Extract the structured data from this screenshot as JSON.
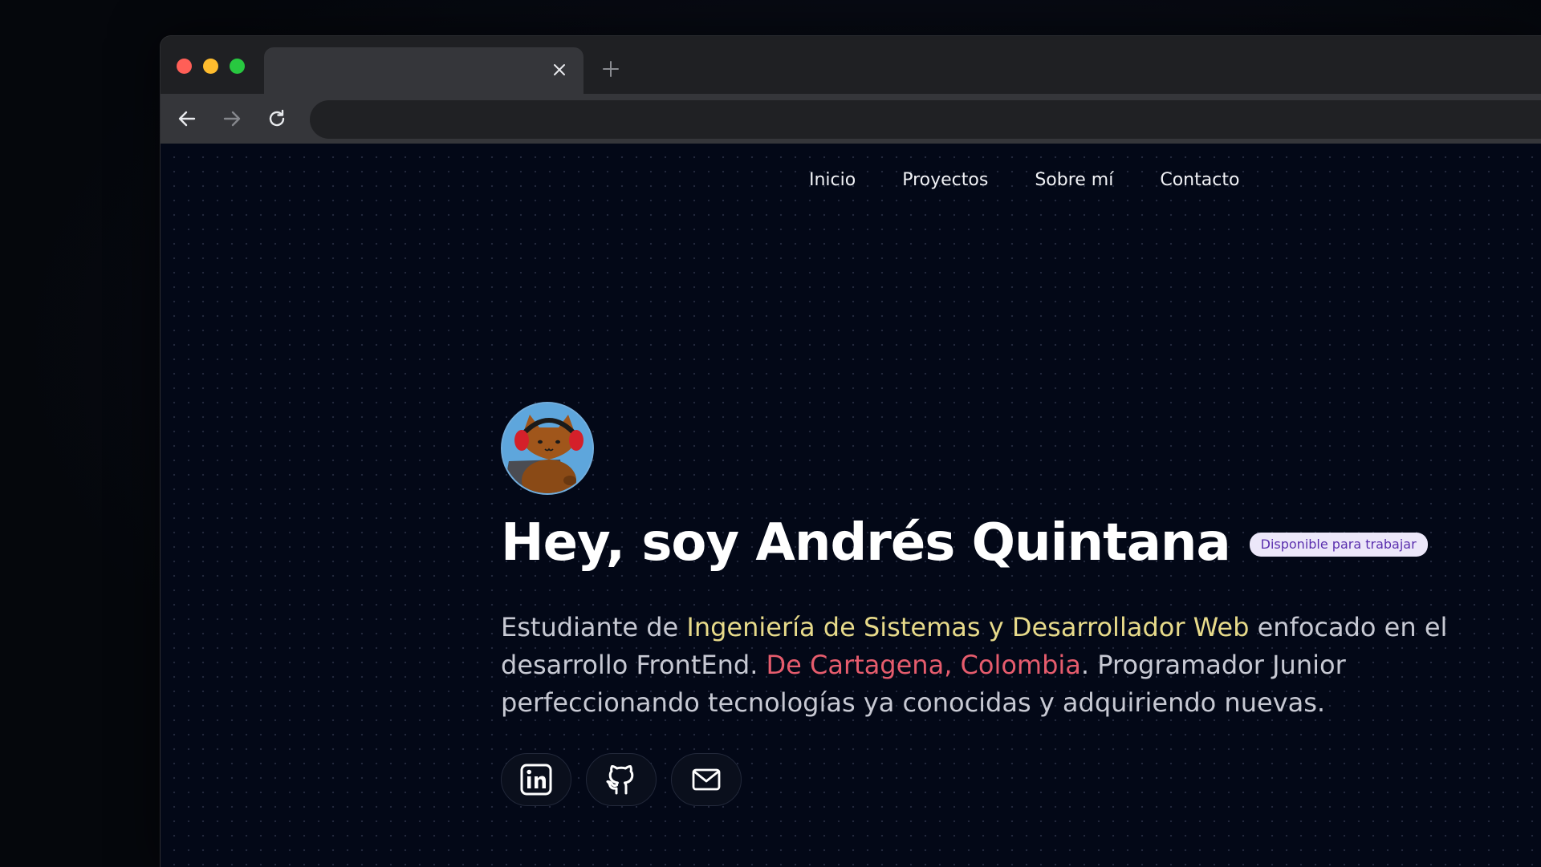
{
  "browser": {
    "tab_title": "",
    "address_value": "",
    "address_placeholder": "",
    "traffic_colors": {
      "close": "#ff5f57",
      "minimize": "#febc2e",
      "maximize": "#28c840"
    }
  },
  "nav": {
    "items": [
      {
        "label": "Inicio"
      },
      {
        "label": "Proyectos"
      },
      {
        "label": "Sobre mí"
      },
      {
        "label": "Contacto"
      }
    ]
  },
  "hero": {
    "avatar_icon": "cat-with-headphones-avatar",
    "title": "Hey, soy Andrés Quintana",
    "badge": "Disponible para trabajar",
    "description": {
      "part1": "Estudiante de ",
      "highlight1": "Ingeniería de Sistemas y Desarrollador Web",
      "part2": " enfocado en el desarrollo FrontEnd. ",
      "highlight2": "De Cartagena, Colombia",
      "part3": ". Programador Junior perfeccionando tecnologías ya conocidas y adquiriendo nuevas."
    },
    "colors": {
      "highlight_yellow": "#e7da8a",
      "highlight_red": "#e65c6d",
      "badge_text": "#5a2fae",
      "badge_bg": "#ece7f9"
    }
  },
  "socials": [
    {
      "icon": "linkedin-icon"
    },
    {
      "icon": "github-icon"
    },
    {
      "icon": "mail-icon"
    }
  ]
}
